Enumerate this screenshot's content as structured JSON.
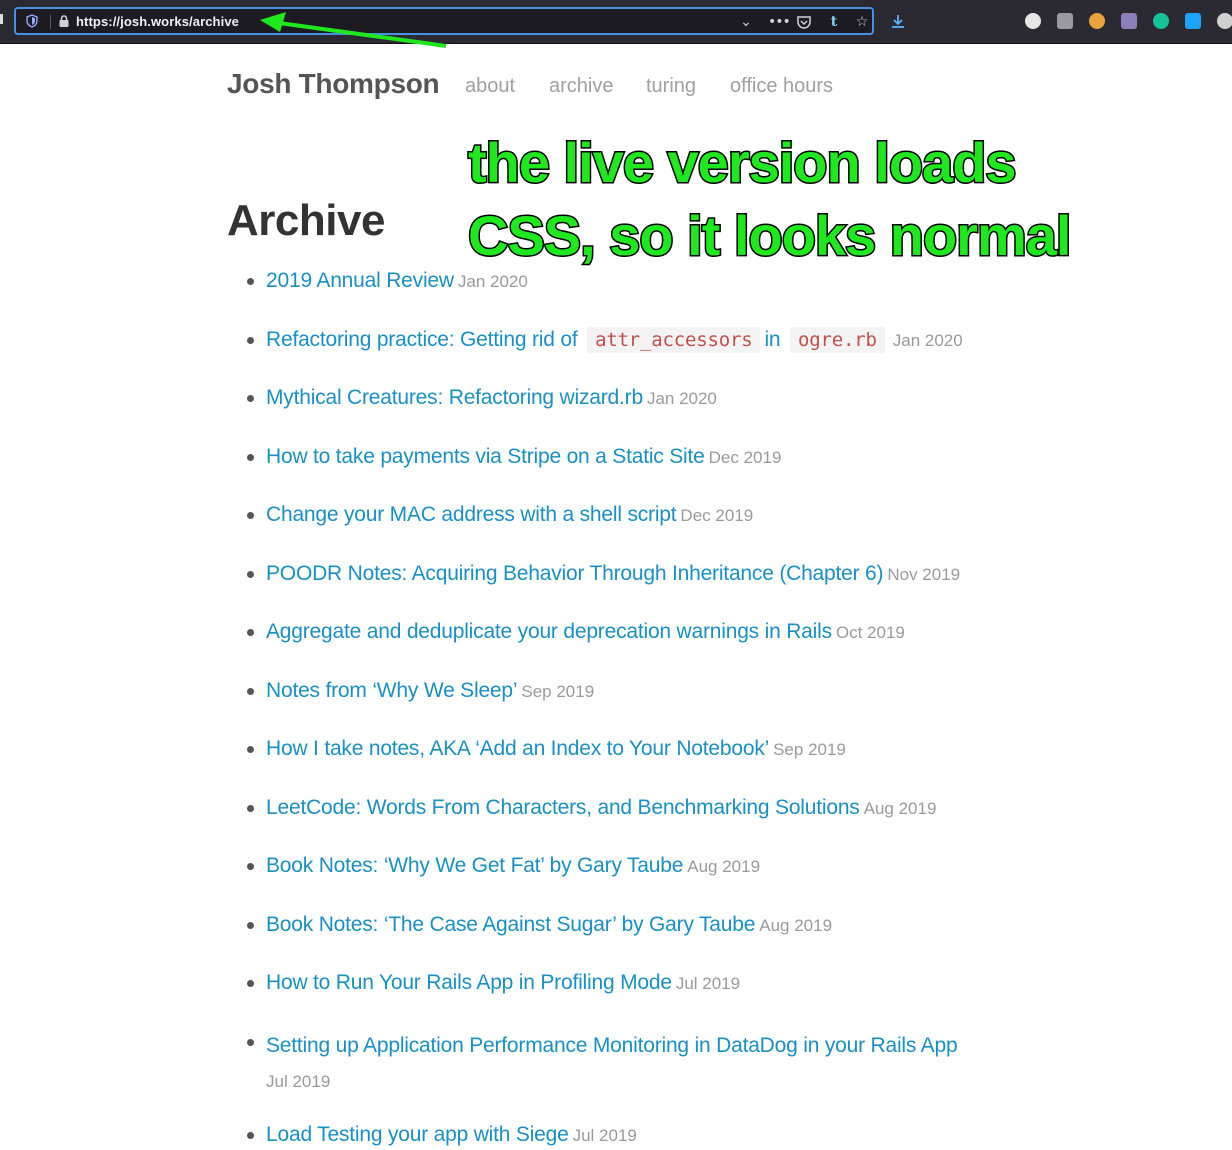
{
  "browser": {
    "url": "https://josh.works/archive",
    "icons": [
      "shield-icon",
      "lock-icon",
      "chevron-down-icon",
      "more-icon",
      "pocket-icon",
      "tumblr-icon",
      "star-icon",
      "download-icon"
    ],
    "extensions": [
      "info-icon",
      "ublock-icon",
      "cookie-icon",
      "github-icon",
      "grammarly-icon",
      "extension-icon"
    ]
  },
  "site": {
    "title": "Josh Thompson",
    "nav": [
      "about",
      "archive",
      "turing",
      "office hours"
    ]
  },
  "page": {
    "title": "Archive"
  },
  "annotation": {
    "line1": "the live version loads",
    "line2": "CSS, so it looks normal",
    "color": "#1fe81f"
  },
  "posts": [
    {
      "title": "2019 Annual Review",
      "date": "Jan 2020"
    },
    {
      "title_pre": "Refactoring practice: Getting rid of",
      "code1": "attr_accessors",
      "mid": "in",
      "code2": "ogre.rb",
      "date": "Jan 2020"
    },
    {
      "title": "Mythical Creatures: Refactoring wizard.rb",
      "date": "Jan 2020"
    },
    {
      "title": "How to take payments via Stripe on a Static Site",
      "date": "Dec 2019"
    },
    {
      "title": "Change your MAC address with a shell script",
      "date": "Dec 2019"
    },
    {
      "title": "POODR Notes: Acquiring Behavior Through Inheritance (Chapter 6)",
      "date": "Nov 2019"
    },
    {
      "title": "Aggregate and deduplicate your deprecation warnings in Rails",
      "date": "Oct 2019"
    },
    {
      "title": "Notes from ‘Why We Sleep’",
      "date": "Sep 2019"
    },
    {
      "title": "How I take notes, AKA ‘Add an Index to Your Notebook’",
      "date": "Sep 2019"
    },
    {
      "title": "LeetCode: Words From Characters, and Benchmarking Solutions",
      "date": "Aug 2019"
    },
    {
      "title": "Book Notes: ‘Why We Get Fat’ by Gary Taube",
      "date": "Aug 2019"
    },
    {
      "title": "Book Notes: ‘The Case Against Sugar’ by Gary Taube",
      "date": "Aug 2019"
    },
    {
      "title": "How to Run Your Rails App in Profiling Mode",
      "date": "Jul 2019"
    },
    {
      "title": "Setting up Application Performance Monitoring in DataDog in your Rails App",
      "date": "Jul 2019"
    },
    {
      "title": "Load Testing your app with Siege",
      "date": "Jul 2019"
    }
  ]
}
